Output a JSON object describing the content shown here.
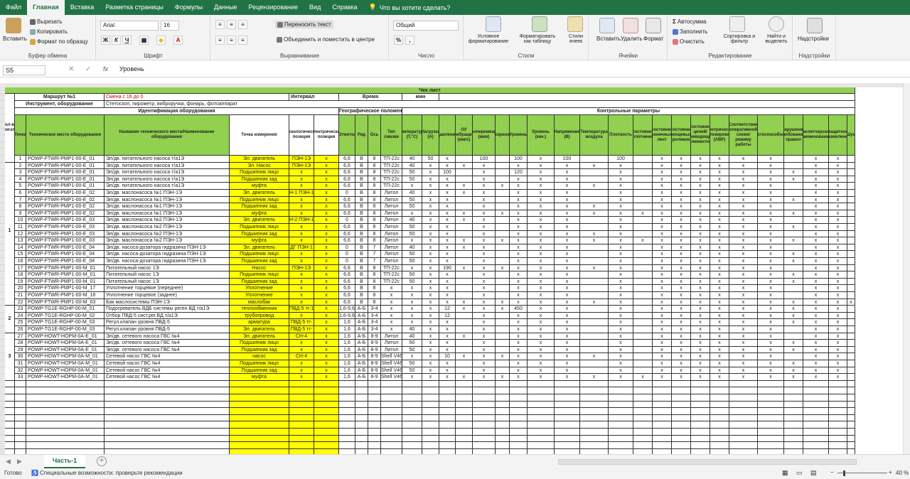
{
  "tabs": [
    "Файл",
    "Главная",
    "Вставка",
    "Разметка страницы",
    "Формулы",
    "Данные",
    "Рецензирование",
    "Вид",
    "Справка"
  ],
  "active_tab": "Главная",
  "tell_me": "Что вы хотите сделать?",
  "ribbon": {
    "clipboard": {
      "paste": "Вставить",
      "cut": "Вырезать",
      "copy": "Копировать",
      "format_painter": "Формат по образцу",
      "label": "Буфер обмена"
    },
    "font": {
      "name": "Arial",
      "size": "16",
      "bold": "Ж",
      "italic": "К",
      "underline": "Ч",
      "label": "Шрифт"
    },
    "alignment": {
      "wrap": "Переносить текст",
      "merge": "Объединить и поместить в центре",
      "label": "Выравнивание"
    },
    "number": {
      "format": "Общий",
      "label": "Число"
    },
    "styles": {
      "cond": "Условное форматирование",
      "table": "Форматировать как таблицу",
      "cell": "Стили ячеек",
      "label": "Стили"
    },
    "cells": {
      "insert": "Вставить",
      "delete": "Удалить",
      "format": "Формат",
      "label": "Ячейки"
    },
    "editing": {
      "autosum": "Автосумма",
      "fill": "Заполнить",
      "clear": "Очистить",
      "sort": "Сортировка и фильтр",
      "find": "Найти и выделить",
      "label": "Редактирование"
    },
    "addins": {
      "addins": "Надстройки",
      "label": "Надстройки"
    }
  },
  "formula_bar": {
    "name_box": "S5",
    "formula": "Уровень"
  },
  "sheet": {
    "title": "Чек лист",
    "route_label": "Маршрут №1",
    "shift": "Смена с 16 до 0",
    "interval_label": "Интервал",
    "time_label": "Время",
    "min_label": "мин",
    "instruments_label": "Инструмент, оборудование",
    "instruments": "Стетоскоп, пирометр, виброручка, фонарь, фотоаппарат",
    "sec_ident": "Идентификация оборудования",
    "sec_geo": "Географическое положение",
    "sec_ctrl": "Контрольные параметры",
    "col_kol": "Кол-во агрегатов",
    "col_num": "Точка",
    "columns": [
      "Техническое место оборудования",
      "Название технического места/Наименование оборудования",
      "Точка измерения",
      "Технологическая позиция",
      "Электрическая позиция",
      "Отметка",
      "Ряд",
      "Ось",
      "Тип смазки",
      "Температура (T,°C)",
      "Нагрузка (A)",
      "Давление",
      "ОУ вибрация (мм/с)",
      "Виброперемещение (мкм)",
      "Искрение",
      "Уровень",
      "Уровень (кач.)",
      "Напряжение (В)",
      "Температура воздуха",
      "Плотность",
      "Состояние уплотнений",
      "Состояние конечных лент",
      "Состояние концевых роликов",
      "Состояние цепей/приводящих элементов",
      "Электрическая блокировка (АВР)",
      "Соответствие оперативной схеме/ режиму работы",
      "Работоспособность",
      "Нарушение требований/ правил",
      "Диспетчерское наименование",
      "Защитное заземление",
      "Шум"
    ],
    "groups": [
      {
        "label": "1",
        "from": 0,
        "to": 21
      },
      {
        "label": "2",
        "from": 22,
        "to": 25
      },
      {
        "label": "3",
        "from": 26,
        "to": 32
      }
    ],
    "rows": [
      [
        "1",
        "POWP-FTWR-PMP1-00-E_01",
        "Эл/дв. питательного насоса т/а1Э",
        "Эл. двигатель",
        "ПЭН-1Э",
        "x",
        "6,6",
        "В",
        "8",
        "ТП-22с",
        "40",
        "50",
        "x",
        "",
        "100",
        "",
        "100",
        "x",
        "100",
        "",
        "100",
        "",
        "x",
        "x",
        "x",
        "x",
        "x",
        "x",
        "",
        "x",
        "x",
        ""
      ],
      [
        "2",
        "POWP-FTWR-PMP1-00-E_01",
        "Эл/дв. питательного насоса т/а1Э",
        "Эл. Насос",
        "ПЭН-1Э",
        "x",
        "6,6",
        "В",
        "8",
        "ТП-22с",
        "40",
        "x",
        "x",
        "x",
        "x",
        "",
        "x",
        "x",
        "x",
        "x",
        "x",
        "",
        "x",
        "x",
        "x",
        "x",
        "x",
        "x",
        "",
        "x",
        "x",
        ""
      ],
      [
        "3",
        "POWP-FTWR-PMP1-00-E_01",
        "Эл/дв. питательного насоса т/а1Э",
        "Подшипник лицо",
        "x",
        "x",
        "6,6",
        "В",
        "8",
        "ТП-22с",
        "50",
        "x",
        "100",
        "",
        "x",
        "",
        "120",
        "x",
        "x",
        "",
        "x",
        "",
        "x",
        "x",
        "x",
        "x",
        "x",
        "x",
        "x",
        "x",
        "x",
        ""
      ],
      [
        "4",
        "POWP-FTWR-PMP1-00-E_01",
        "Эл/дв. питательного насоса т/а1Э",
        "Подшипник зад",
        "x",
        "x",
        "6,6",
        "В",
        "8",
        "ТП-22с",
        "50",
        "x",
        "x",
        "",
        "x",
        "",
        "x",
        "x",
        "x",
        "",
        "x",
        "",
        "x",
        "x",
        "x",
        "x",
        "x",
        "x",
        "x",
        "x",
        "x",
        ""
      ],
      [
        "5",
        "POWP-FTWR-PMP1-00-E_01",
        "Эл/дв. питательного насоса т/а1Э",
        "муфта",
        "x",
        "x",
        "6,6",
        "В",
        "8",
        "ТП-22с",
        "x",
        "x",
        "x",
        "x",
        "x",
        "x",
        "x",
        "x",
        "x",
        "x",
        "x",
        "",
        "x",
        "x",
        "x",
        "x",
        "x",
        "x",
        "",
        "x",
        "x",
        ""
      ],
      [
        "6",
        "POWP-FTWR-PMP1-00-E_02",
        "Эл/дв. маслонасоса №1 ПЭН-1Э",
        "Эл. двигатель",
        "Н-1 ПЭН-1",
        "x",
        "0",
        "В",
        "8",
        "Литол",
        "40",
        "x",
        "x",
        "x",
        "x",
        "",
        "x",
        "x",
        "x",
        "",
        "x",
        "",
        "x",
        "x",
        "x",
        "x",
        "x",
        "x",
        "",
        "x",
        "x",
        ""
      ],
      [
        "7",
        "POWP-FTWR-PMP1-00-E_02",
        "Эл/дв. маслонасоса №1 ПЭН-1Э",
        "Подшипник лицо",
        "x",
        "x",
        "6,6",
        "В",
        "8",
        "Литол",
        "50",
        "x",
        "x",
        "",
        "x",
        "",
        "x",
        "x",
        "x",
        "",
        "x",
        "",
        "x",
        "x",
        "x",
        "x",
        "x",
        "x",
        "x",
        "x",
        "x",
        ""
      ],
      [
        "8",
        "POWP-FTWR-PMP1-00-E_02",
        "Эл/дв. маслонасоса №1 ПЭН-1Э",
        "Подшипник зад",
        "x",
        "x",
        "6,6",
        "В",
        "8",
        "Литол",
        "50",
        "x",
        "x",
        "",
        "x",
        "",
        "x",
        "x",
        "x",
        "x",
        "x",
        "",
        "x",
        "x",
        "x",
        "x",
        "x",
        "x",
        "",
        "x",
        "x",
        ""
      ],
      [
        "9",
        "POWP-FTWR-PMP1-00-E_02",
        "Эл/дв. маслонасоса №1 ПЭН-1Э",
        "муфта",
        "x",
        "x",
        "6,6",
        "В",
        "8",
        "Литол",
        "x",
        "x",
        "x",
        "x",
        "x",
        "x",
        "x",
        "x",
        "x",
        "x",
        "x",
        "x",
        "x",
        "x",
        "x",
        "x",
        "x",
        "x",
        "x",
        "x",
        "x",
        ""
      ],
      [
        "10",
        "POWP-FTWR-PMP1-00-E_03",
        "Эл/дв. маслонасоса №2 ПЭН-1Э",
        "Эл. двигатель",
        "Н-2 ПЭН-1",
        "x",
        "0",
        "В",
        "8",
        "Литол",
        "40",
        "x",
        "x",
        "x",
        "x",
        "",
        "x",
        "x",
        "x",
        "",
        "x",
        "",
        "x",
        "x",
        "x",
        "x",
        "x",
        "x",
        "",
        "x",
        "x",
        ""
      ],
      [
        "11",
        "POWP-FTWR-PMP1-00-E_03",
        "Эл/дв. маслонасоса №2 ПЭН-1Э",
        "Подшипник лицо",
        "x",
        "x",
        "6,6",
        "В",
        "8",
        "Литол",
        "50",
        "x",
        "x",
        "",
        "x",
        "",
        "x",
        "x",
        "x",
        "",
        "x",
        "",
        "x",
        "x",
        "x",
        "x",
        "x",
        "x",
        "x",
        "x",
        "x",
        ""
      ],
      [
        "12",
        "POWP-FTWR-PMP1-00-E_03",
        "Эл/дв. маслонасоса №2 ПЭН-1Э",
        "Подшипник зад",
        "x",
        "x",
        "6,6",
        "В",
        "8",
        "Литол",
        "50",
        "x",
        "x",
        "",
        "x",
        "",
        "x",
        "x",
        "x",
        "x",
        "x",
        "",
        "x",
        "x",
        "x",
        "x",
        "x",
        "x",
        "",
        "x",
        "x",
        ""
      ],
      [
        "13",
        "POWP-FTWR-PMP1-00-E_03",
        "Эл/дв. маслонасоса №2 ПЭН-1Э",
        "муфта",
        "x",
        "x",
        "6,6",
        "В",
        "8",
        "Литол",
        "x",
        "x",
        "x",
        "x",
        "x",
        "x",
        "x",
        "x",
        "x",
        "x",
        "x",
        "x",
        "x",
        "x",
        "x",
        "x",
        "x",
        "x",
        "x",
        "x",
        "x",
        ""
      ],
      [
        "14",
        "POWP-FTWR-PMP1-00-E_04",
        "Эл/дв. насоса-дозатора гидразина ПЭН-1Э",
        "Эл. двигатель",
        "ДГ ПЭН-1",
        "x",
        "0",
        "В",
        "7",
        "Литол",
        "40",
        "x",
        "x",
        "x",
        "x",
        "",
        "x",
        "x",
        "x",
        "",
        "x",
        "",
        "x",
        "x",
        "x",
        "x",
        "x",
        "x",
        "",
        "x",
        "x",
        ""
      ],
      [
        "15",
        "POWP-FTWR-PMP1-00-E_04",
        "Эл/дв. насоса-дозатора гидразина ПЭН-1Э",
        "Подшипник лицо",
        "x",
        "x",
        "0",
        "В",
        "7",
        "Литол",
        "50",
        "x",
        "x",
        "",
        "x",
        "",
        "x",
        "x",
        "x",
        "",
        "x",
        "",
        "x",
        "x",
        "x",
        "x",
        "x",
        "x",
        "x",
        "x",
        "x",
        ""
      ],
      [
        "16",
        "POWP-FTWR-PMP1-00-E_04",
        "Эл/дв. насоса-дозатора гидразина ПЭН-1Э",
        "Подшипник зад",
        "x",
        "x",
        "0",
        "В",
        "7",
        "Литол",
        "50",
        "x",
        "x",
        "",
        "x",
        "",
        "x",
        "x",
        "x",
        "",
        "x",
        "",
        "x",
        "x",
        "x",
        "x",
        "x",
        "x",
        "x",
        "x",
        "x",
        ""
      ],
      [
        "17",
        "POWP-FTWR-PMP1-00-M_01",
        "Питательный насос 1Э",
        "Насос",
        "ПЭН-1Э",
        "x",
        "6,6",
        "В",
        "8",
        "ТП-22с",
        "x",
        "x",
        "190",
        "x",
        "x",
        "x",
        "x",
        "x",
        "x",
        "x",
        "x",
        "",
        "x",
        "x",
        "x",
        "x",
        "x",
        "x",
        "",
        "x",
        "x",
        ""
      ],
      [
        "18",
        "POWP-FTWR-PMP1-00-M_01",
        "Питательный насос 1Э",
        "Подшипник лицо",
        "x",
        "x",
        "6,6",
        "В",
        "8",
        "ТП-22с",
        "50",
        "x",
        "x",
        "",
        "x",
        "",
        "x",
        "x",
        "x",
        "",
        "x",
        "",
        "x",
        "x",
        "x",
        "x",
        "x",
        "x",
        "x",
        "x",
        "x",
        ""
      ],
      [
        "19",
        "POWP-FTWR-PMP1-00-M_01",
        "Питательный насос 1Э",
        "Подшипник зад",
        "x",
        "x",
        "6,6",
        "В",
        "8",
        "ТП-22с",
        "50",
        "x",
        "x",
        "",
        "x",
        "",
        "x",
        "x",
        "x",
        "",
        "x",
        "",
        "x",
        "x",
        "x",
        "x",
        "x",
        "x",
        "x",
        "x",
        "x",
        ""
      ],
      [
        "20",
        "POWP-FTWR-PMP1-00-M_17",
        "Уплотнение торцевое (переднее)",
        "Уплотнение",
        "x",
        "x",
        "6,6",
        "В",
        "8",
        "x",
        "x",
        "x",
        "x",
        "",
        "x",
        "",
        "x",
        "x",
        "x",
        "",
        "x",
        "",
        "x",
        "x",
        "x",
        "x",
        "x",
        "x",
        "",
        "x",
        "x",
        ""
      ],
      [
        "21",
        "POWP-FTWR-PMP1-00-M_18",
        "Уплотнение торцевое (заднее)",
        "Уплотнение",
        "x",
        "x",
        "6,6",
        "В",
        "8",
        "x",
        "x",
        "x",
        "x",
        "",
        "x",
        "",
        "x",
        "x",
        "x",
        "",
        "x",
        "",
        "x",
        "x",
        "x",
        "x",
        "x",
        "x",
        "",
        "x",
        "x",
        ""
      ],
      [
        "22",
        "POWP-FTWR-PMP1-00-M_03",
        "Бак маслосистемы ПЭН-1Э",
        "маслобак",
        "x",
        "x",
        "6,6",
        "В",
        "8",
        "x",
        "x",
        "x",
        "x",
        "x",
        "x",
        "x",
        "x",
        "x",
        "x",
        "x",
        "x",
        "",
        "x",
        "x",
        "x",
        "x",
        "x",
        "x",
        "x",
        "x",
        "x",
        "x"
      ],
      [
        "23",
        "POWP-TG1E-RGHP-00-M_01",
        "Подогреватель ВДБ системы реген ВД т/а1Э",
        "теплообменник",
        "ПВД-5 тг-1",
        "x",
        "1,6-9,6",
        "А-Б",
        "3-4",
        "x",
        "x",
        "x",
        "12",
        "x",
        "x",
        "x",
        "450",
        "x",
        "x",
        "",
        "x",
        "",
        "x",
        "x",
        "x",
        "x",
        "x",
        "x",
        "x",
        "x",
        "x",
        ""
      ],
      [
        "24",
        "POWP-TG1E-RGHP-00-M_02",
        "Отбор ПВД-5 сист.рег.ВД т/а1Э",
        "трубопровод",
        "x",
        "x",
        "1,6-9,6",
        "А-Б",
        "3-4",
        "x",
        "x",
        "x",
        "12",
        "",
        "x",
        "",
        "x",
        "x",
        "x",
        "",
        "x",
        "",
        "x",
        "x",
        "x",
        "x",
        "x",
        "x",
        "x",
        "x",
        "x",
        ""
      ],
      [
        "25",
        "POWP-TG1E-RGHP-00-M_03",
        "Регул.клапан уровня ПВД-5",
        "арматура",
        "ПВД-5 тг-",
        "x",
        "1,6",
        "А-Б",
        "3-4",
        "x",
        "x",
        "x",
        "x",
        "",
        "x",
        "",
        "x",
        "x",
        "x",
        "",
        "x",
        "",
        "x",
        "x",
        "x",
        "x",
        "x",
        "x",
        "x",
        "x",
        "x",
        ""
      ],
      [
        "26",
        "POWP-TG1E-RGHP-00-M_03",
        "Регул.клапан уровня ПВД-5",
        "Эл. двигатель",
        "ПВД-5 тг-",
        "x",
        "1,6",
        "А-Б",
        "3-4",
        "x",
        "40",
        "x",
        "x",
        "",
        "x",
        "",
        "x",
        "x",
        "x",
        "",
        "x",
        "",
        "x",
        "x",
        "x",
        "x",
        "x",
        "x",
        "",
        "x",
        "x",
        ""
      ],
      [
        "27",
        "POWP-HOWT-HOPM-0A-E_01",
        "Эл/дв. сетевого насоса ГВС №4",
        "Эл. двигатель",
        "СН-4",
        "x",
        "1,6",
        "А-Б",
        "8-9",
        "Литол",
        "40",
        "x",
        "x",
        "x",
        "x",
        "",
        "x",
        "x",
        "x",
        "",
        "x",
        "",
        "x",
        "x",
        "x",
        "x",
        "x",
        "x",
        "",
        "x",
        "x",
        ""
      ],
      [
        "28",
        "POWP-HOWT-HOPM-0A-E_01",
        "Эл/дв. сетевого насоса ГВС №4",
        "Подшипник лицо",
        "x",
        "x",
        "1,6",
        "А-Б",
        "8-9",
        "Литол",
        "50",
        "x",
        "x",
        "",
        "x",
        "",
        "x",
        "x",
        "x",
        "",
        "x",
        "",
        "x",
        "x",
        "x",
        "x",
        "x",
        "x",
        "x",
        "x",
        "x",
        ""
      ],
      [
        "29",
        "POWP-HOWT-HOPM-0A-E_01",
        "Эл/дв. сетевого насоса ГВС №4",
        "Подшипник зад",
        "x",
        "x",
        "1,6",
        "А-Б",
        "8-9",
        "Литол",
        "50",
        "x",
        "x",
        "",
        "x",
        "",
        "x",
        "x",
        "x",
        "",
        "x",
        "",
        "x",
        "x",
        "x",
        "x",
        "x",
        "x",
        "x",
        "x",
        "x",
        ""
      ],
      [
        "30",
        "POWP-HOWT-HOPM-0A-M_01",
        "Сетевой насос ГВС №4",
        "насос",
        "СН-4",
        "x",
        "1,6",
        "А-Б",
        "8-9",
        "Shell V46",
        "x",
        "x",
        "10",
        "x",
        "x",
        "x",
        "x",
        "x",
        "x",
        "x",
        "x",
        "",
        "x",
        "x",
        "x",
        "x",
        "x",
        "x",
        "",
        "x",
        "x",
        ""
      ],
      [
        "31",
        "POWP-HOWT-HOPM-0A-M_01",
        "Сетевой насос ГВС №4",
        "Подшипник лицо",
        "x",
        "x",
        "1,6",
        "А-Б",
        "8-9",
        "Shell V46",
        "50",
        "x",
        "x",
        "",
        "x",
        "",
        "x",
        "x",
        "x",
        "",
        "x",
        "",
        "x",
        "x",
        "x",
        "x",
        "x",
        "x",
        "x",
        "x",
        "x",
        ""
      ],
      [
        "32",
        "POWP-HOWT-HOPM-0A-M_01",
        "Сетевой насос ГВС №4",
        "Подшипник зад",
        "x",
        "x",
        "1,6",
        "А-Б",
        "8-9",
        "Shell V46",
        "50",
        "x",
        "x",
        "",
        "x",
        "",
        "x",
        "x",
        "x",
        "",
        "x",
        "",
        "x",
        "x",
        "x",
        "x",
        "x",
        "x",
        "x",
        "x",
        "x",
        ""
      ],
      [
        "33",
        "POWP-HOWT-HOPM-0A-M_01",
        "Сетевой насос ГВС №4",
        "муфта",
        "x",
        "x",
        "1,6",
        "А-Б",
        "8-9",
        "Shell V46",
        "x",
        "x",
        "x",
        "x",
        "x",
        "x",
        "x",
        "x",
        "x",
        "x",
        "x",
        "x",
        "x",
        "x",
        "x",
        "x",
        "x",
        "x",
        "x",
        "x",
        "x",
        ""
      ]
    ]
  },
  "sheet_tab": "Часть-1",
  "status": {
    "ready": "Готово",
    "accessibility": "Специальные возможности: проверьте рекомендации",
    "zoom": "40 %"
  }
}
